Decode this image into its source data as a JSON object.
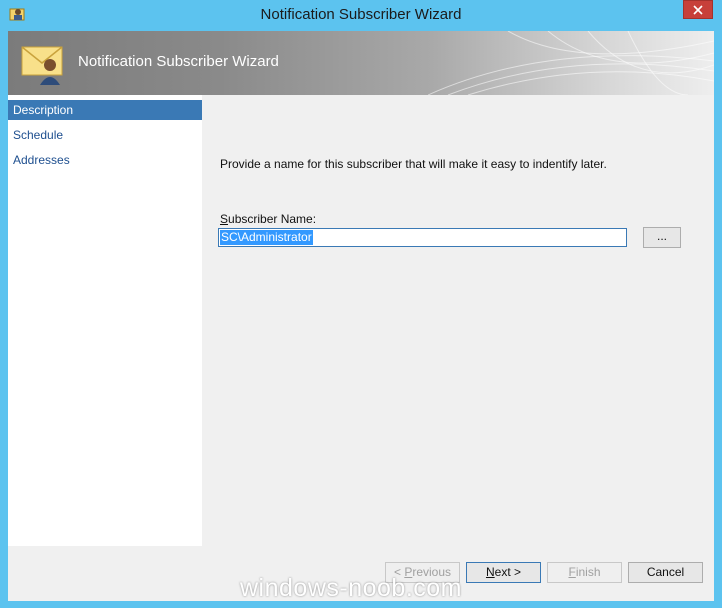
{
  "window": {
    "title": "Notification Subscriber Wizard"
  },
  "banner": {
    "title": "Notification Subscriber Wizard"
  },
  "nav": {
    "items": [
      {
        "label": "Description",
        "active": true
      },
      {
        "label": "Schedule",
        "active": false
      },
      {
        "label": "Addresses",
        "active": false
      }
    ]
  },
  "content": {
    "instruction": "Provide a name for this subscriber that will make it easy to indentify later.",
    "label_first": "S",
    "label_rest": "ubscriber Name:",
    "subscriber_name": "SC\\Administrator",
    "browse_label": "..."
  },
  "footer": {
    "previous": "< Previous",
    "previous_mn": "P",
    "previous_pre": "< ",
    "previous_rest": "revious",
    "next_mn": "N",
    "next_rest": "ext >",
    "finish_mn": "F",
    "finish_rest": "inish",
    "cancel": "Cancel"
  },
  "watermark": "windows-noob.com",
  "colors": {
    "titlebar": "#5cc3ef",
    "selection": "#3a79b5",
    "close": "#c7403a"
  },
  "icons": {
    "title": "wizard-app-icon",
    "banner": "envelope-user-icon",
    "close": "close-icon"
  }
}
